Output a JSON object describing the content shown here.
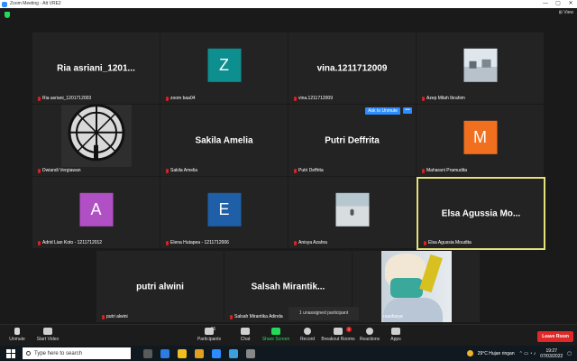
{
  "window": {
    "title": "Zoom Meeting - Att VRE2",
    "controls": [
      "—",
      "▢",
      "✕"
    ]
  },
  "meeting": {
    "view_label": "⊞ View"
  },
  "tiles": [
    {
      "name": "Ria  asriani_1201...",
      "label": "Ria asriani_1201712003"
    },
    {
      "initial": "Z",
      "color": "#0e8f8f",
      "label": "zoom baa04"
    },
    {
      "name": "vina.1211712009",
      "label": "vina.1211712009"
    },
    {
      "label": "Azep Milah Ibrahim"
    },
    {
      "label": "Dwiandi Vergiawan"
    },
    {
      "name": "Sakila Amelia",
      "label": "Sakila Amelia"
    },
    {
      "name": "Putri Deffrita",
      "label": "Putri Deffrita",
      "ask_unmute": "Ask to Unmute",
      "more": "•••"
    },
    {
      "initial": "M",
      "color": "#f07020",
      "label": "Maharani Pramudita"
    },
    {
      "initial": "A",
      "color": "#b14fc5",
      "label": "Adrid Lian Koto - 1211712012"
    },
    {
      "initial": "E",
      "color": "#1e5fa8",
      "label": "Elena Hutapea - 1211712006"
    },
    {
      "label": "Anisya Azahra"
    },
    {
      "name": "Elsa  Agussia  Mo...",
      "label": "Elsa Agussia Moudita"
    },
    {
      "name": "putri alwini",
      "label": "putri alwini"
    },
    {
      "name": "Salsah  Mirantik...",
      "label": "Salsah Mirantika Adinda"
    },
    {
      "label": "raasfasya"
    }
  ],
  "popup": {
    "text": "1 unassigned participant"
  },
  "toolbar": {
    "unmute": "Unmute",
    "start_video": "Start Video",
    "participants": "Participants",
    "participants_count": "15",
    "chat": "Chat",
    "share_screen": "Share Screen",
    "record": "Record",
    "breakout": "Breakout Rooms",
    "breakout_badge": "1",
    "reactions": "Reactions",
    "apps": "Apps",
    "leave": "Leave Room"
  },
  "taskbar": {
    "search_placeholder": "Type here to search",
    "weather": "29°C  Hujan ringan",
    "time": "19:27",
    "date": "07/03/2022",
    "icon_colors": [
      "#5a5a5a",
      "#2a7de1",
      "#f0c020",
      "#e0a020",
      "#2d8cff",
      "#3aa0e0",
      "#888888"
    ]
  }
}
